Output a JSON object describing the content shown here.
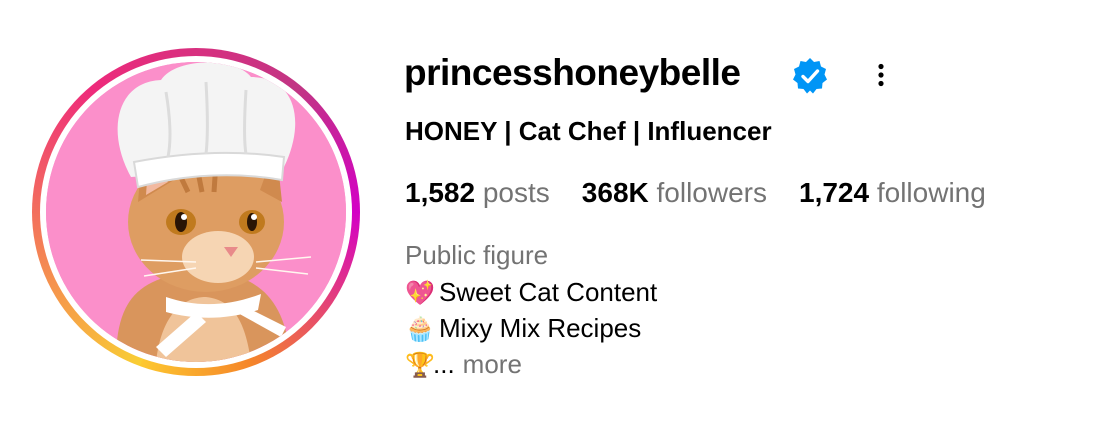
{
  "profile": {
    "username": "princesshoneybelle",
    "display_name": "HONEY | Cat Chef | Influencer",
    "verified": true,
    "category": "Public figure"
  },
  "stats": {
    "posts_count": "1,582",
    "posts_label": "posts",
    "followers_count": "368K",
    "followers_label": "followers",
    "following_count": "1,724",
    "following_label": "following"
  },
  "bio": {
    "line1_emoji": "💖",
    "line1_text": "Sweet Cat Content",
    "line2_emoji": "🧁",
    "line2_text": "Mixy Mix Recipes",
    "line3_emoji": "🏆",
    "line3_text": "...",
    "more_label": "more"
  },
  "icons": {
    "verified": "verified-badge-icon",
    "options": "more-options-icon"
  },
  "colors": {
    "verified_blue": "#0095f6",
    "secondary_text": "#737373",
    "avatar_background": "#fb8fca"
  }
}
